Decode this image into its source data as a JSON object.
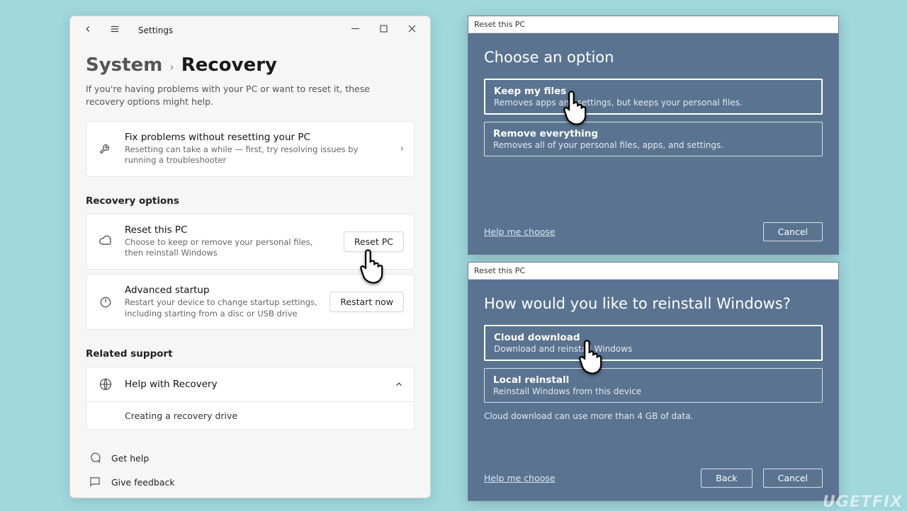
{
  "settings": {
    "app_title": "Settings",
    "breadcrumb": {
      "parent": "System",
      "current": "Recovery"
    },
    "lead": "If you're having problems with your PC or want to reset it, these recovery options might help.",
    "fix_card": {
      "title": "Fix problems without resetting your PC",
      "sub": "Resetting can take a while — first, try resolving issues by running a troubleshooter"
    },
    "section_recovery": "Recovery options",
    "reset_card": {
      "title": "Reset this PC",
      "sub": "Choose to keep or remove your personal files, then reinstall Windows",
      "button": "Reset PC"
    },
    "advanced_card": {
      "title": "Advanced startup",
      "sub": "Restart your device to change startup settings, including starting from a disc or USB drive",
      "button": "Restart now"
    },
    "section_related": "Related support",
    "help_card": {
      "title": "Help with Recovery",
      "sub_link": "Creating a recovery drive"
    },
    "footer": {
      "help": "Get help",
      "feedback": "Give feedback"
    }
  },
  "dialog1": {
    "titlebar": "Reset this PC",
    "heading": "Choose an option",
    "options": [
      {
        "title": "Keep my files",
        "desc": "Removes apps and settings, but keeps your personal files."
      },
      {
        "title": "Remove everything",
        "desc": "Removes all of your personal files, apps, and settings."
      }
    ],
    "help_link": "Help me choose",
    "cancel": "Cancel"
  },
  "dialog2": {
    "titlebar": "Reset this PC",
    "heading": "How would you like to reinstall Windows?",
    "options": [
      {
        "title": "Cloud download",
        "desc": "Download and reinstall Windows"
      },
      {
        "title": "Local reinstall",
        "desc": "Reinstall Windows from this device"
      }
    ],
    "note": "Cloud download can use more than 4 GB of data.",
    "help_link": "Help me choose",
    "back": "Back",
    "cancel": "Cancel"
  },
  "watermark": "UGETFIX"
}
